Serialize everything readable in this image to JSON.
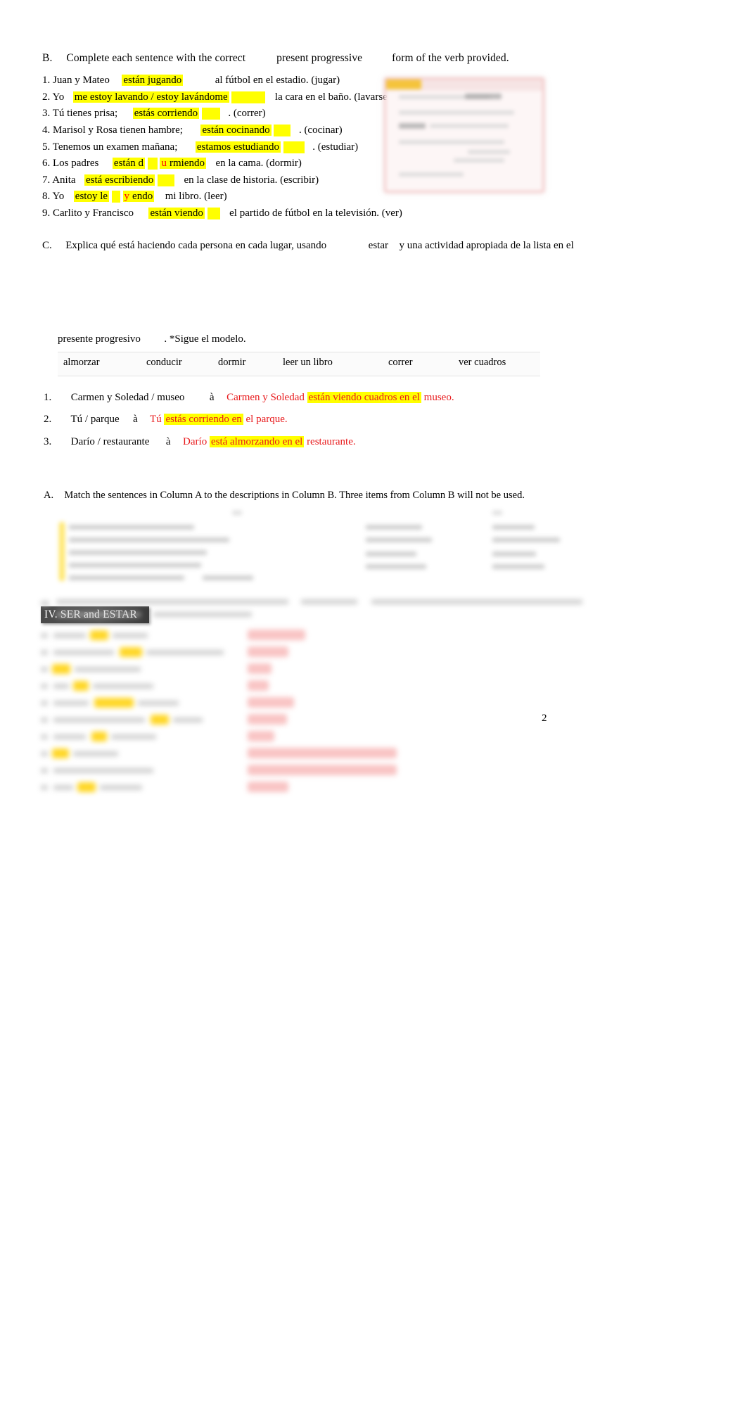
{
  "document": {
    "page_number": "2",
    "language": "Spanish worksheet (answer key)"
  },
  "section_b": {
    "label": "B.",
    "instruction_part1": "Complete each sentence with the correct",
    "instruction_emphasis": "present progressive",
    "instruction_part2": "form of the verb provided.",
    "items": [
      {
        "number": "1.",
        "pre": "Juan y Mateo",
        "answer": "están jugando",
        "answer_red": "",
        "answer_tail": "",
        "post": "al fútbol en el estadio. (jugar)"
      },
      {
        "number": "2.",
        "pre": "Yo",
        "answer": "me estoy lavando / estoy lavándome",
        "answer_red": "",
        "answer_tail": "",
        "post": "la cara en el baño. (lavarse)"
      },
      {
        "number": "3.",
        "pre": "Tú tienes prisa;",
        "answer": "estás corriendo",
        "answer_red": "",
        "answer_tail": "",
        "post": ". (correr)"
      },
      {
        "number": "4.",
        "pre": "Marisol y Rosa tienen hambre;",
        "answer": "están cocinando",
        "answer_red": "",
        "answer_tail": "",
        "post": ". (cocinar)"
      },
      {
        "number": "5.",
        "pre": "Tenemos un examen mañana;",
        "answer": "estamos estudiando",
        "answer_red": "",
        "answer_tail": "",
        "post": ". (estudiar)"
      },
      {
        "number": "6.",
        "pre": "Los padres",
        "answer": "están d",
        "answer_red": "u",
        "answer_tail": "rmiendo",
        "post": "en la cama. (dormir)"
      },
      {
        "number": "7.",
        "pre": "Anita",
        "answer": "está escribiendo",
        "answer_red": "",
        "answer_tail": "",
        "post": "en la clase de historia. (escribir)"
      },
      {
        "number": "8.",
        "pre": "Yo",
        "answer": "estoy le",
        "answer_red": "y",
        "answer_tail": "endo",
        "post": "mi libro. (leer)"
      },
      {
        "number": "9.",
        "pre": "Carlito y Francisco",
        "answer": "están viendo",
        "answer_red": "",
        "answer_tail": "",
        "post": "el partido de fútbol en la televisión. (ver)"
      }
    ]
  },
  "section_c": {
    "label": "C.",
    "instruction_part1": "Explica qué está haciendo cada persona en cada lugar, usando",
    "instruction_emphasis": "estar",
    "instruction_part2": "y una actividad apropiada de la lista en el",
    "instruction_emphasis2": "presente progresivo",
    "instruction_part3": ". *Sigue el modelo.",
    "word_bank": [
      "almorzar",
      "conducir",
      "dormir",
      "leer un libro",
      "correr",
      "ver cuadros"
    ],
    "items": [
      {
        "number": "1.",
        "prompt": "Carmen y Soledad / museo",
        "arrow": "à",
        "answer_pre": "Carmen y Soledad ",
        "answer_hl": "están viendo cuadros en el",
        "answer_post": " museo."
      },
      {
        "number": "2.",
        "prompt": "Tú / parque",
        "arrow": "à",
        "answer_pre": "Tú ",
        "answer_hl": "estás corriendo en",
        "answer_post": " el parque."
      },
      {
        "number": "3.",
        "prompt": "Darío / restaurante",
        "arrow": "à",
        "answer_pre": "Darío ",
        "answer_hl": "está almorzando en el",
        "answer_post": " restaurante."
      }
    ]
  },
  "section_iv": {
    "heading": "IV. SER and ESTAR",
    "part_a": {
      "label": "A.",
      "instruction": "Match the sentences in Column A to the descriptions in Column B. Three items from Column B will not be used."
    },
    "blurred_note": "Remaining content on the page is out of focus and not legible."
  }
}
